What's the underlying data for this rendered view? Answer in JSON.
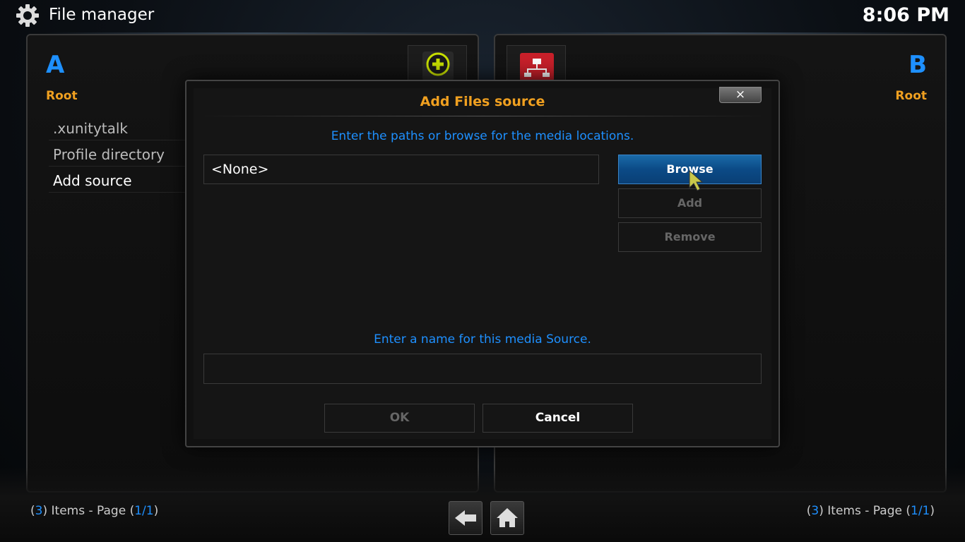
{
  "header": {
    "icon": "gear-icon",
    "title": "File manager",
    "clock": "8:06 PM"
  },
  "pane_a": {
    "letter": "A",
    "path": "Root",
    "items": [
      ".xunitytalk",
      "Profile directory",
      "Add source"
    ],
    "footer": {
      "count": "3",
      "items_label": " Items - Page ",
      "page": "1/1"
    }
  },
  "pane_b": {
    "letter": "B",
    "path": "Root",
    "footer": {
      "count": "3",
      "items_label": " Items - Page ",
      "page": "1/1"
    }
  },
  "dialog": {
    "title": "Add Files source",
    "close_label": "×",
    "path_prompt": "Enter the paths or browse for the media locations.",
    "path_value": "<None>",
    "browse_label": "Browse",
    "add_label": "Add",
    "remove_label": "Remove",
    "name_prompt": "Enter a name for this media Source.",
    "name_value": "",
    "ok_label": "OK",
    "cancel_label": "Cancel"
  },
  "nav": {
    "back_icon": "back-arrow-icon",
    "home_icon": "home-icon"
  },
  "colors": {
    "accent_blue": "#1e90ff",
    "accent_orange": "#f0a020",
    "focus_button": "#0b4a86"
  }
}
